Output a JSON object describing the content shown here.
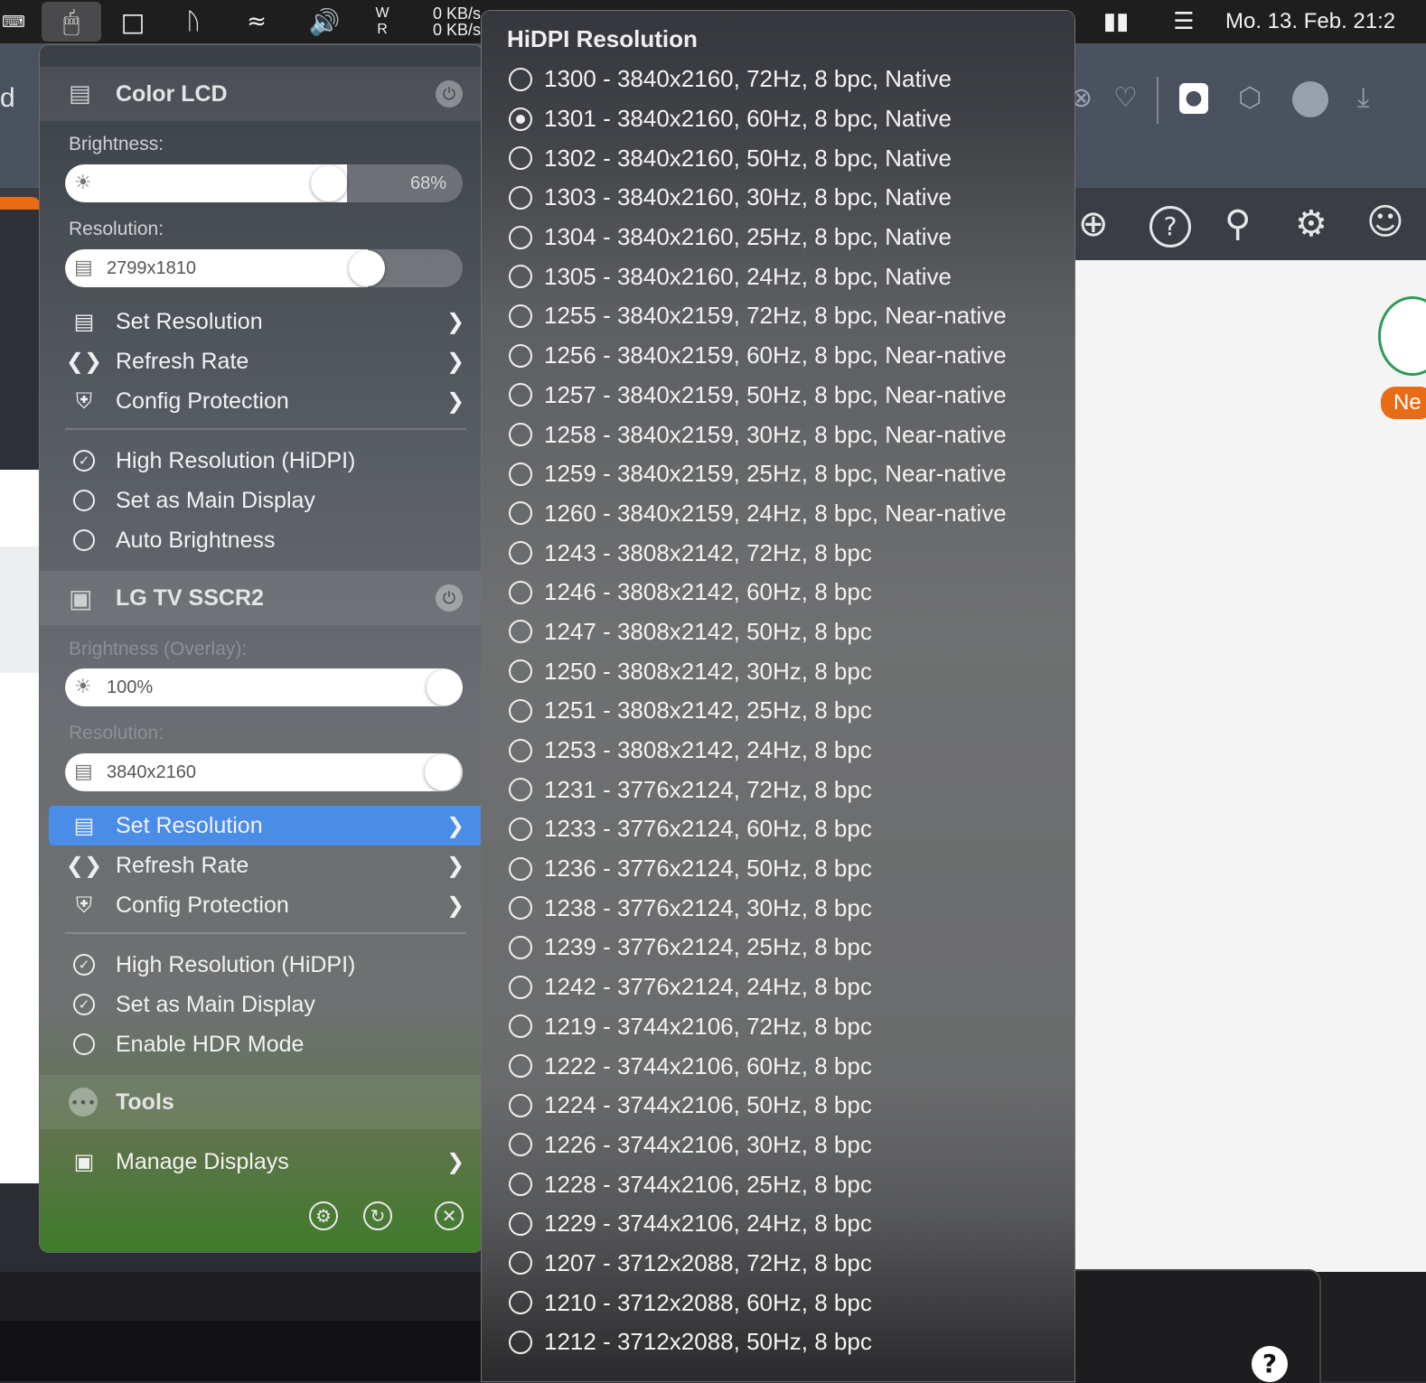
{
  "menubar": {
    "net_up": "0 KB/s",
    "net_down": "0 KB/s",
    "wr_top": "W",
    "wr_bottom": "R",
    "clock": "Mo. 13. Feb.  21:2"
  },
  "background": {
    "partial_text": "d",
    "new_badge": "Ne",
    "help_glyph": "?"
  },
  "panel": {
    "displays": [
      {
        "name": "Color LCD",
        "brightness_label": "Brightness:",
        "brightness_value": "68%",
        "brightness_fraction": 0.68,
        "resolution_label": "Resolution:",
        "resolution_value": "2799x1810",
        "menu": {
          "set_resolution": "Set Resolution",
          "refresh_rate": "Refresh Rate",
          "config_protection": "Config Protection"
        },
        "toggles": [
          {
            "label": "High Resolution (HiDPI)",
            "checked": true
          },
          {
            "label": "Set as Main Display",
            "checked": false
          },
          {
            "label": "Auto Brightness",
            "checked": false
          }
        ]
      },
      {
        "name": "LG TV SSCR2",
        "brightness_label": "Brightness (Overlay):",
        "brightness_value": "100%",
        "brightness_fraction": 1.0,
        "resolution_label": "Resolution:",
        "resolution_value": "3840x2160",
        "menu": {
          "set_resolution": "Set Resolution",
          "refresh_rate": "Refresh Rate",
          "config_protection": "Config Protection"
        },
        "toggles": [
          {
            "label": "High Resolution (HiDPI)",
            "checked": true
          },
          {
            "label": "Set as Main Display",
            "checked": true
          },
          {
            "label": "Enable HDR Mode",
            "checked": false
          }
        ]
      }
    ],
    "tools": "Tools",
    "manage_displays": "Manage Displays"
  },
  "submenu": {
    "title": "HiDPI Resolution",
    "selected": 1,
    "items": [
      "1300 - 3840x2160, 72Hz, 8 bpc, Native",
      "1301 - 3840x2160, 60Hz, 8 bpc, Native",
      "1302 - 3840x2160, 50Hz, 8 bpc, Native",
      "1303 - 3840x2160, 30Hz, 8 bpc, Native",
      "1304 - 3840x2160, 25Hz, 8 bpc, Native",
      "1305 - 3840x2160, 24Hz, 8 bpc, Native",
      "1255 - 3840x2159, 72Hz, 8 bpc, Near-native",
      "1256 - 3840x2159, 60Hz, 8 bpc, Near-native",
      "1257 - 3840x2159, 50Hz, 8 bpc, Near-native",
      "1258 - 3840x2159, 30Hz, 8 bpc, Near-native",
      "1259 - 3840x2159, 25Hz, 8 bpc, Near-native",
      "1260 - 3840x2159, 24Hz, 8 bpc, Near-native",
      "1243 - 3808x2142, 72Hz, 8 bpc",
      "1246 - 3808x2142, 60Hz, 8 bpc",
      "1247 - 3808x2142, 50Hz, 8 bpc",
      "1250 - 3808x2142, 30Hz, 8 bpc",
      "1251 - 3808x2142, 25Hz, 8 bpc",
      "1253 - 3808x2142, 24Hz, 8 bpc",
      "1231 - 3776x2124, 72Hz, 8 bpc",
      "1233 - 3776x2124, 60Hz, 8 bpc",
      "1236 - 3776x2124, 50Hz, 8 bpc",
      "1238 - 3776x2124, 30Hz, 8 bpc",
      "1239 - 3776x2124, 25Hz, 8 bpc",
      "1242 - 3776x2124, 24Hz, 8 bpc",
      "1219 - 3744x2106, 72Hz, 8 bpc",
      "1222 - 3744x2106, 60Hz, 8 bpc",
      "1224 - 3744x2106, 50Hz, 8 bpc",
      "1226 - 3744x2106, 30Hz, 8 bpc",
      "1228 - 3744x2106, 25Hz, 8 bpc",
      "1229 - 3744x2106, 24Hz, 8 bpc",
      "1207 - 3712x2088, 72Hz, 8 bpc",
      "1210 - 3712x2088, 60Hz, 8 bpc",
      "1212 - 3712x2088, 50Hz, 8 bpc"
    ]
  },
  "colors": {
    "highlight": "#4a8de8",
    "accent_orange": "#e86b15",
    "accent_green": "#2e9a56"
  }
}
